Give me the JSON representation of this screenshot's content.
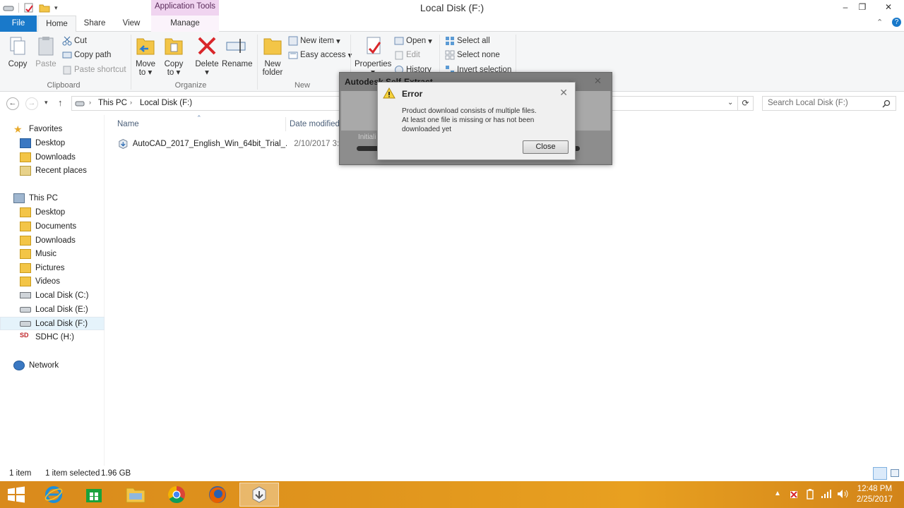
{
  "window": {
    "title": "Local Disk (F:)",
    "contextual_tab_group": "Application Tools"
  },
  "tabs": {
    "file": "File",
    "home": "Home",
    "share": "Share",
    "view": "View",
    "manage": "Manage"
  },
  "ribbon": {
    "clipboard": {
      "label": "Clipboard",
      "copy": "Copy",
      "paste": "Paste",
      "cut": "Cut",
      "copy_path": "Copy path",
      "paste_shortcut": "Paste shortcut"
    },
    "organize": {
      "label": "Organize",
      "move_to": "Move",
      "move_to_2": "to",
      "copy_to": "Copy",
      "copy_to_2": "to",
      "delete": "Delete",
      "rename": "Rename"
    },
    "new": {
      "label": "New",
      "new_folder": "New",
      "new_folder_2": "folder",
      "new_item": "New item",
      "easy_access": "Easy access"
    },
    "open": {
      "properties": "Properties",
      "open": "Open",
      "edit": "Edit",
      "history": "History"
    },
    "select": {
      "select_all": "Select all",
      "select_none": "Select none",
      "invert": "Invert selection"
    }
  },
  "address": {
    "crumbs": [
      "This PC",
      "Local Disk (F:)"
    ],
    "search_placeholder": "Search Local Disk (F:)"
  },
  "nav": {
    "favorites": "Favorites",
    "fav_items": [
      "Desktop",
      "Downloads",
      "Recent places"
    ],
    "this_pc": "This PC",
    "pc_items": [
      "Desktop",
      "Documents",
      "Downloads",
      "Music",
      "Pictures",
      "Videos",
      "Local Disk (C:)",
      "Local Disk (E:)",
      "Local Disk (F:)",
      "SDHC (H:)"
    ],
    "network": "Network"
  },
  "files": {
    "columns": {
      "name": "Name",
      "date": "Date modified"
    },
    "rows": [
      {
        "name": "AutoCAD_2017_English_Win_64bit_Trial_...",
        "date": "2/10/2017 3:42"
      }
    ]
  },
  "status": {
    "count": "1 item",
    "selected": "1 item selected",
    "size": "1.96 GB"
  },
  "autodesk_dialog": {
    "title": "Autodesk Self-Extract",
    "status": "Initiali"
  },
  "error_dialog": {
    "title": "Error",
    "message_1": "Product download consists of multiple files.",
    "message_2": "At least one file is missing or has not been",
    "message_3": "downloaded yet",
    "close_button": "Close"
  },
  "taskbar": {
    "time": "12:48 PM",
    "date": "2/25/2017"
  },
  "colors": {
    "file_tab": "#1979ca",
    "taskbar": "#e0951d",
    "context_tab": "#f0d4f0"
  }
}
